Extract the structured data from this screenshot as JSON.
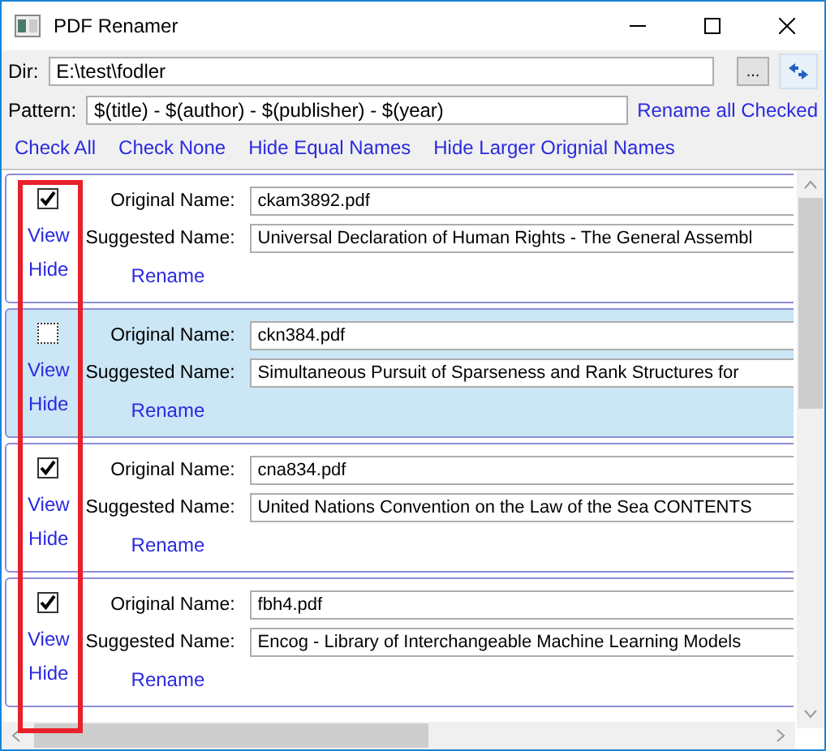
{
  "window": {
    "title": "PDF Renamer"
  },
  "dir": {
    "label": "Dir:",
    "value": "E:\\test\\fodler",
    "browse": "..."
  },
  "pattern": {
    "label": "Pattern:",
    "value": "$(title) - $(author) - $(publisher) - $(year)",
    "action": "Rename all Checked"
  },
  "actions": [
    "Check All",
    "Check None",
    "Hide Equal Names",
    "Hide Larger Orignial Names"
  ],
  "items": [
    {
      "checked": true,
      "selected": false,
      "original_label": "Original Name:",
      "original": "ckam3892.pdf",
      "suggested_label": "Suggested Name:",
      "suggested": "Universal Declaration of Human Rights - The General Assembl",
      "view": "View",
      "hide": "Hide",
      "rename": "Rename"
    },
    {
      "checked": false,
      "selected": true,
      "original_label": "Original Name:",
      "original": "ckn384.pdf",
      "suggested_label": "Suggested Name:",
      "suggested": "Simultaneous Pursuit of Sparseness and Rank Structures for",
      "view": "View",
      "hide": "Hide",
      "rename": "Rename"
    },
    {
      "checked": true,
      "selected": false,
      "original_label": "Original Name:",
      "original": "cna834.pdf",
      "suggested_label": "Suggested Name:",
      "suggested": "United Nations Convention on the Law of the Sea CONTENTS",
      "view": "View",
      "hide": "Hide",
      "rename": "Rename"
    },
    {
      "checked": true,
      "selected": false,
      "original_label": "Original Name:",
      "original": "fbh4.pdf",
      "suggested_label": "Suggested Name:",
      "suggested": "Encog - Library of Interchangeable Machine Learning Models",
      "view": "View",
      "hide": "Hide",
      "rename": "Rename"
    }
  ]
}
